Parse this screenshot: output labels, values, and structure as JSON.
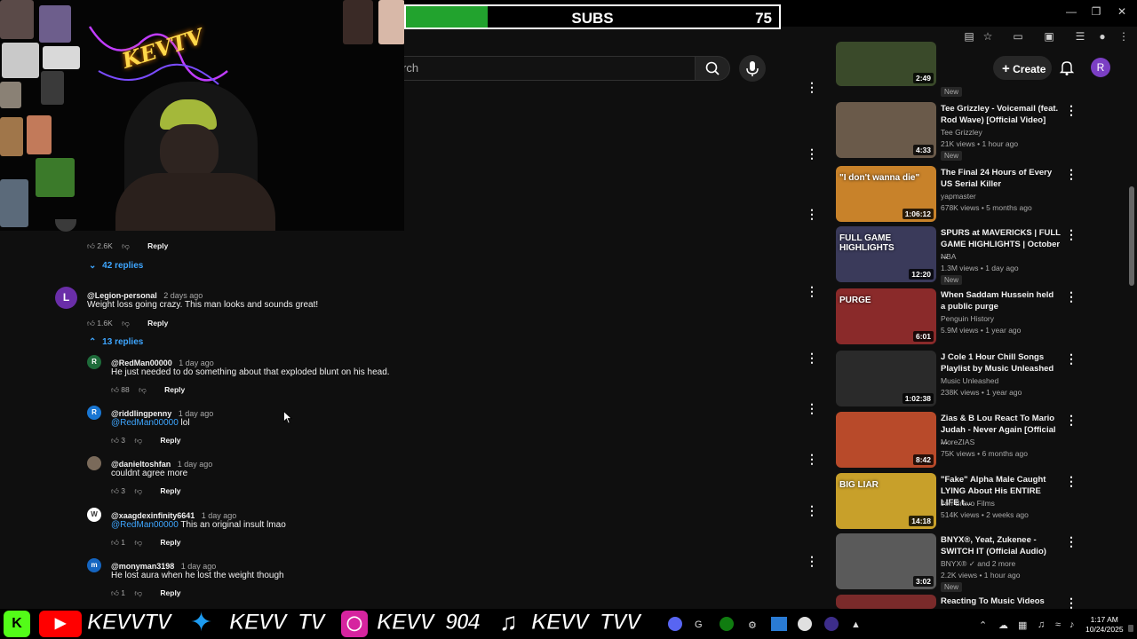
{
  "subs": {
    "label": "SUBS",
    "count": "75",
    "progress": 0.22
  },
  "overlay": {
    "neon_text": "KEVTV"
  },
  "search": {
    "placeholder": "rch"
  },
  "header": {
    "create_label": "Create",
    "avatar_letter": "R"
  },
  "comments": [
    {
      "id": "top0",
      "actions": {
        "likes": "2.6K",
        "reply": "Reply"
      },
      "replies_toggle": "42 replies"
    },
    {
      "id": "c1",
      "avatar": "L",
      "avatar_color": "#6a2ea8",
      "user": "@Legion-personal",
      "date": "2 days ago",
      "text": "Weight loss going crazy. This man looks and sounds great!",
      "likes": "1.6K",
      "reply": "Reply",
      "replies_toggle": "13 replies"
    }
  ],
  "replies": [
    {
      "avatar": "R",
      "avatar_color": "#1e6b3a",
      "user": "@RedMan00000",
      "date": "1 day ago",
      "mention": "",
      "text": "He just needed to do something about that exploded blunt on his head.",
      "likes": "88",
      "reply": "Reply"
    },
    {
      "avatar": "R",
      "avatar_color": "#1976d2",
      "user": "@riddlingpenny",
      "date": "1 day ago",
      "mention": "@RedMan00000",
      "text": " lol",
      "likes": "3",
      "reply": "Reply"
    },
    {
      "avatar": "",
      "avatar_color": "#7a6a5a",
      "user": "@danieltoshfan",
      "date": "1 day ago",
      "mention": "",
      "text": "couldnt agree more",
      "likes": "3",
      "reply": "Reply"
    },
    {
      "avatar": "W",
      "avatar_color": "#ffffff",
      "user": "@xaagdexinfinity6641",
      "date": "1 day ago",
      "mention": "@RedMan00000",
      "text": " This an original insult lmao",
      "likes": "1",
      "reply": "Reply"
    },
    {
      "avatar": "m",
      "avatar_color": "#1565c0",
      "user": "@monyman3198",
      "date": "1 day ago",
      "mention": "",
      "text": "He lost aura when he lost the weight though",
      "likes": "1",
      "reply": "Reply"
    }
  ],
  "videos": [
    {
      "title": "",
      "channel": "",
      "meta": "",
      "duration": "2:49",
      "badge": "New"
    },
    {
      "title": "Tee Grizzley - Voicemail (feat. Rod Wave) [Official Video]",
      "channel": "Tee Grizzley",
      "meta": "21K views • 1 hour ago",
      "duration": "4:33",
      "badge": "New"
    },
    {
      "title": "The Final 24 Hours of Every US Serial Killer",
      "channel": "yapmaster",
      "meta": "678K views • 5 months ago",
      "duration": "1:06:12",
      "badge": "",
      "thumb_caption": "\"I don't wanna die\""
    },
    {
      "title": "SPURS at MAVERICKS | FULL GAME HIGHLIGHTS | October ...",
      "channel": "NBA",
      "meta": "1.3M views • 1 day ago",
      "duration": "12:20",
      "badge": "New",
      "thumb_caption": "FULL GAME HIGHLIGHTS"
    },
    {
      "title": "When Saddam Hussein held a public purge",
      "channel": "Penguin History",
      "meta": "5.9M views • 1 year ago",
      "duration": "6:01",
      "badge": "",
      "thumb_caption": "PURGE"
    },
    {
      "title": "J Cole 1   Hour Chill Songs Playlist by Music Unleashed",
      "channel": "Music Unleashed",
      "meta": "238K views • 1 year ago",
      "duration": "1:02:38",
      "badge": ""
    },
    {
      "title": "Zias & B Lou React To Mario Judah - Never Again [Official ...",
      "channel": "MoreZIAS",
      "meta": "75K views • 6 months ago",
      "duration": "8:42",
      "badge": ""
    },
    {
      "title": "\"Fake\" Alpha Male Caught LYING About His ENTIRE LIFE t...",
      "channel": "Jon Bravo Films",
      "meta": "514K views • 2 weeks ago",
      "duration": "14:18",
      "badge": "",
      "thumb_caption": "BIG LIAR"
    },
    {
      "title": "BNYX®, Yeat, Zukenee - SWITCH IT (Official Audio)",
      "channel": "BNYX® ✓ and 2 more",
      "meta": "2.2K views • 1 hour ago",
      "duration": "3:02",
      "badge": "New"
    },
    {
      "title": "Reacting To Music Videos With",
      "channel": "",
      "meta": "",
      "duration": "",
      "badge": ""
    }
  ],
  "banner": {
    "handle1": "KEVVTV",
    "handle2": "KEVV_TV",
    "handle3": "KEVV_904",
    "handle4": "KEVV_TVV"
  },
  "taskbar": {
    "time": "1:17 AM",
    "date": "10/24/2025"
  },
  "colors": {
    "subs_fill": "#22a32e",
    "link": "#3ea6ff",
    "youtube_red": "#ff0000",
    "twitter_blue": "#1d9bf0"
  }
}
